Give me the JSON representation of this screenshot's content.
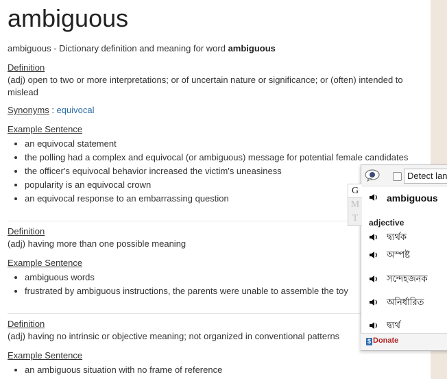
{
  "title": "ambiguous",
  "intro": {
    "prefix": "ambiguous - Dictionary definition and meaning for word ",
    "word": "ambiguous"
  },
  "labels": {
    "definition": "Definition",
    "synonyms": "Synonyms",
    "synonyms_sep": " : ",
    "example": "Example Sentence"
  },
  "senses": [
    {
      "definition": "(adj) open to two or more interpretations; or of uncertain nature or significance; or (often) intended to mislead",
      "synonym": "equivocal",
      "examples": [
        "an equivocal statement",
        "the polling had a complex and equivocal (or ambiguous) message for potential female candidates",
        "the officer's equivocal behavior increased the victim's uneasiness",
        "popularity is an equivocal crown",
        "an equivocal response to an embarrassing question"
      ]
    },
    {
      "definition": "(adj) having more than one possible meaning",
      "examples": [
        "ambiguous words",
        "frustrated by ambiguous instructions, the parents were unable to assemble the toy"
      ]
    },
    {
      "definition": "(adj) having no intrinsic or objective meaning; not organized in conventional patterns",
      "examples": [
        "an ambiguous situation with no frame of reference"
      ]
    }
  ],
  "popup": {
    "detect_label": "Detect lan",
    "tabs": [
      "G",
      "M",
      "T"
    ],
    "word": "ambiguous",
    "part_of_speech": "adjective",
    "translations": [
      "দ্ব্যর্থক",
      "অস্পষ্ট",
      "সন্দেহজনক",
      "অনির্ধারিত",
      "দ্ব্যর্থ"
    ],
    "donate_label": "Donate",
    "icons": {
      "bubble": "speech-bubble-icon",
      "speaker": "speaker-icon",
      "donate": "dollar-icon"
    }
  }
}
